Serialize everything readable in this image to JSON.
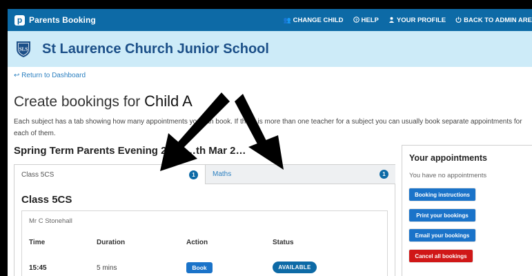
{
  "topbar": {
    "brand": "Parents Booking",
    "nav": [
      {
        "icon": "users-icon",
        "glyph": "👥",
        "label": "CHANGE CHILD"
      },
      {
        "icon": "help-icon",
        "glyph": "?",
        "label": "HELP"
      },
      {
        "icon": "profile-icon",
        "glyph": "👤",
        "label": "YOUR PROFILE"
      },
      {
        "icon": "power-icon",
        "glyph": "⏻",
        "label": "BACK TO ADMIN ARE"
      }
    ]
  },
  "school": {
    "name": "St Laurence Church Junior School",
    "crest_initials": "SLS"
  },
  "content": {
    "back_link": "Return to Dashboard",
    "title_prefix": "Create bookings for",
    "child_name": "Child A",
    "intro": "Each subject has a tab showing how many appointments you can book. If there is more than one teacher for a subject you can usually book separate appointments for each of them.",
    "event_title": "Spring Term Parents Evening 20…  …th Mar 2…"
  },
  "tabs": [
    {
      "label": "Class 5CS",
      "count": "1"
    },
    {
      "label": "Maths",
      "count": "1"
    }
  ],
  "class_panel": {
    "heading": "Class 5CS",
    "teacher": "Mr C Stonehall",
    "columns": {
      "time": "Time",
      "duration": "Duration",
      "action": "Action",
      "status": "Status"
    },
    "row": {
      "time": "15:45",
      "duration": "5 mins",
      "action": "Book",
      "status": "AVAILABLE"
    }
  },
  "appointments": {
    "title": "Your appointments",
    "empty": "You have no appointments",
    "buttons": {
      "instructions": "Booking instructions",
      "print": "Print your bookings",
      "email": "Email your bookings",
      "cancel": "Cancel all bookings"
    }
  },
  "colors": {
    "brand": "#0d6aa6",
    "school_bar": "#cdebf8",
    "danger": "#d01717",
    "link": "#2a7fc0"
  }
}
